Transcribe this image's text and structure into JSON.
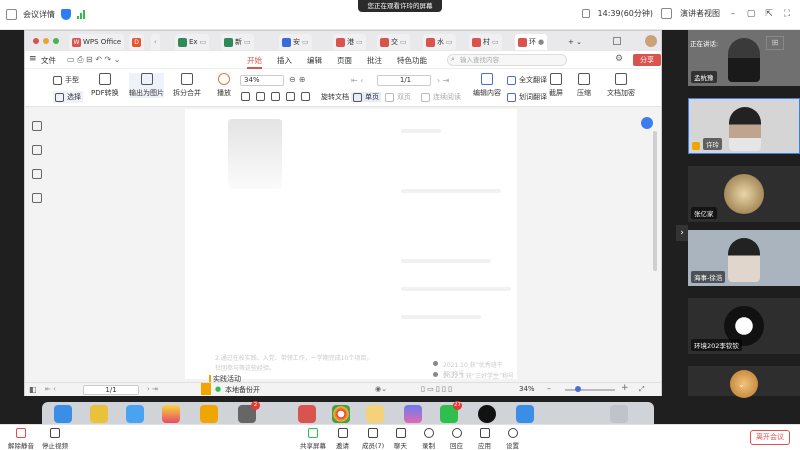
{
  "meeting": {
    "title": "会议详情",
    "watching_banner": "您正在观看许玲的屏幕",
    "timer": "14:39(60分钟)",
    "view_mode": "演讲者视图",
    "speaking_label": "正在讲话:",
    "leave_label": "离开会议"
  },
  "wps": {
    "home_tab": "WPS Office",
    "tabs": [
      {
        "label": "Ex",
        "color": "#2e8b57"
      },
      {
        "label": "新",
        "color": "#2e8b57"
      },
      {
        "label": "安",
        "color": "#3b6bd6"
      },
      {
        "label": "港",
        "color": "#d9534f"
      },
      {
        "label": "交",
        "color": "#d9534f"
      },
      {
        "label": "水",
        "color": "#d9534f"
      },
      {
        "label": "村",
        "color": "#d9534f"
      },
      {
        "label": "环",
        "color": "#d9534f"
      }
    ],
    "menu": [
      "文件",
      "开始",
      "插入",
      "编辑",
      "页面",
      "批注",
      "特色功能"
    ],
    "active_menu": "开始",
    "search_placeholder": "输入查找内容",
    "share": "分享",
    "ribbon": {
      "hand": "手型",
      "select": "选择",
      "pdf_convert": "PDF转换",
      "export_image": "输出为图片",
      "split_merge": "拆分合并",
      "play": "播放",
      "zoom": "34%",
      "page": "1/1",
      "rotate": "旋转文档",
      "single_page": "单页",
      "double_page": "双页",
      "continuous": "连续阅读",
      "edit_content": "编辑内容",
      "full_translate": "全文翻译",
      "word_translate": "划词翻译",
      "screenshot": "截屏",
      "compress": "压缩",
      "encrypt": "文档加密"
    },
    "doc": {
      "section_title": "实践活动",
      "items": [
        "2021.10 获“优秀班干部”称号",
        "2022.3 获“三好学生”称号"
      ],
      "faint_line": "2.通过在校实践、入党、带领工作，一学期完成10个项目，",
      "faint_line2": "社团参与等这些经验。"
    },
    "status": {
      "backup": "本地备份开",
      "page": "1/1",
      "zoom": "34%"
    }
  },
  "participants": [
    {
      "name": "孟杭豫",
      "type": "video"
    },
    {
      "name": "许玲",
      "type": "video"
    },
    {
      "name": "张亿家",
      "type": "avatar"
    },
    {
      "name": "海事-徐浩",
      "type": "video"
    },
    {
      "name": "环境202李钦钦",
      "type": "avatar"
    },
    {
      "name": "",
      "type": "avatar"
    }
  ],
  "dock_badges": {
    "settings": "2",
    "wechat": "27"
  },
  "toolbar": {
    "mute": "解除静音",
    "stop_video": "停止视频",
    "share_screen": "共享屏幕",
    "invite": "邀请",
    "members": "成员(7)",
    "chat": "聊天",
    "record": "录制",
    "reactions": "回应",
    "apps": "应用",
    "settings": "设置"
  },
  "colors": {
    "wps_red": "#d9534f",
    "accent_blue": "#3c7ef0",
    "leave_red": "#e05050"
  }
}
